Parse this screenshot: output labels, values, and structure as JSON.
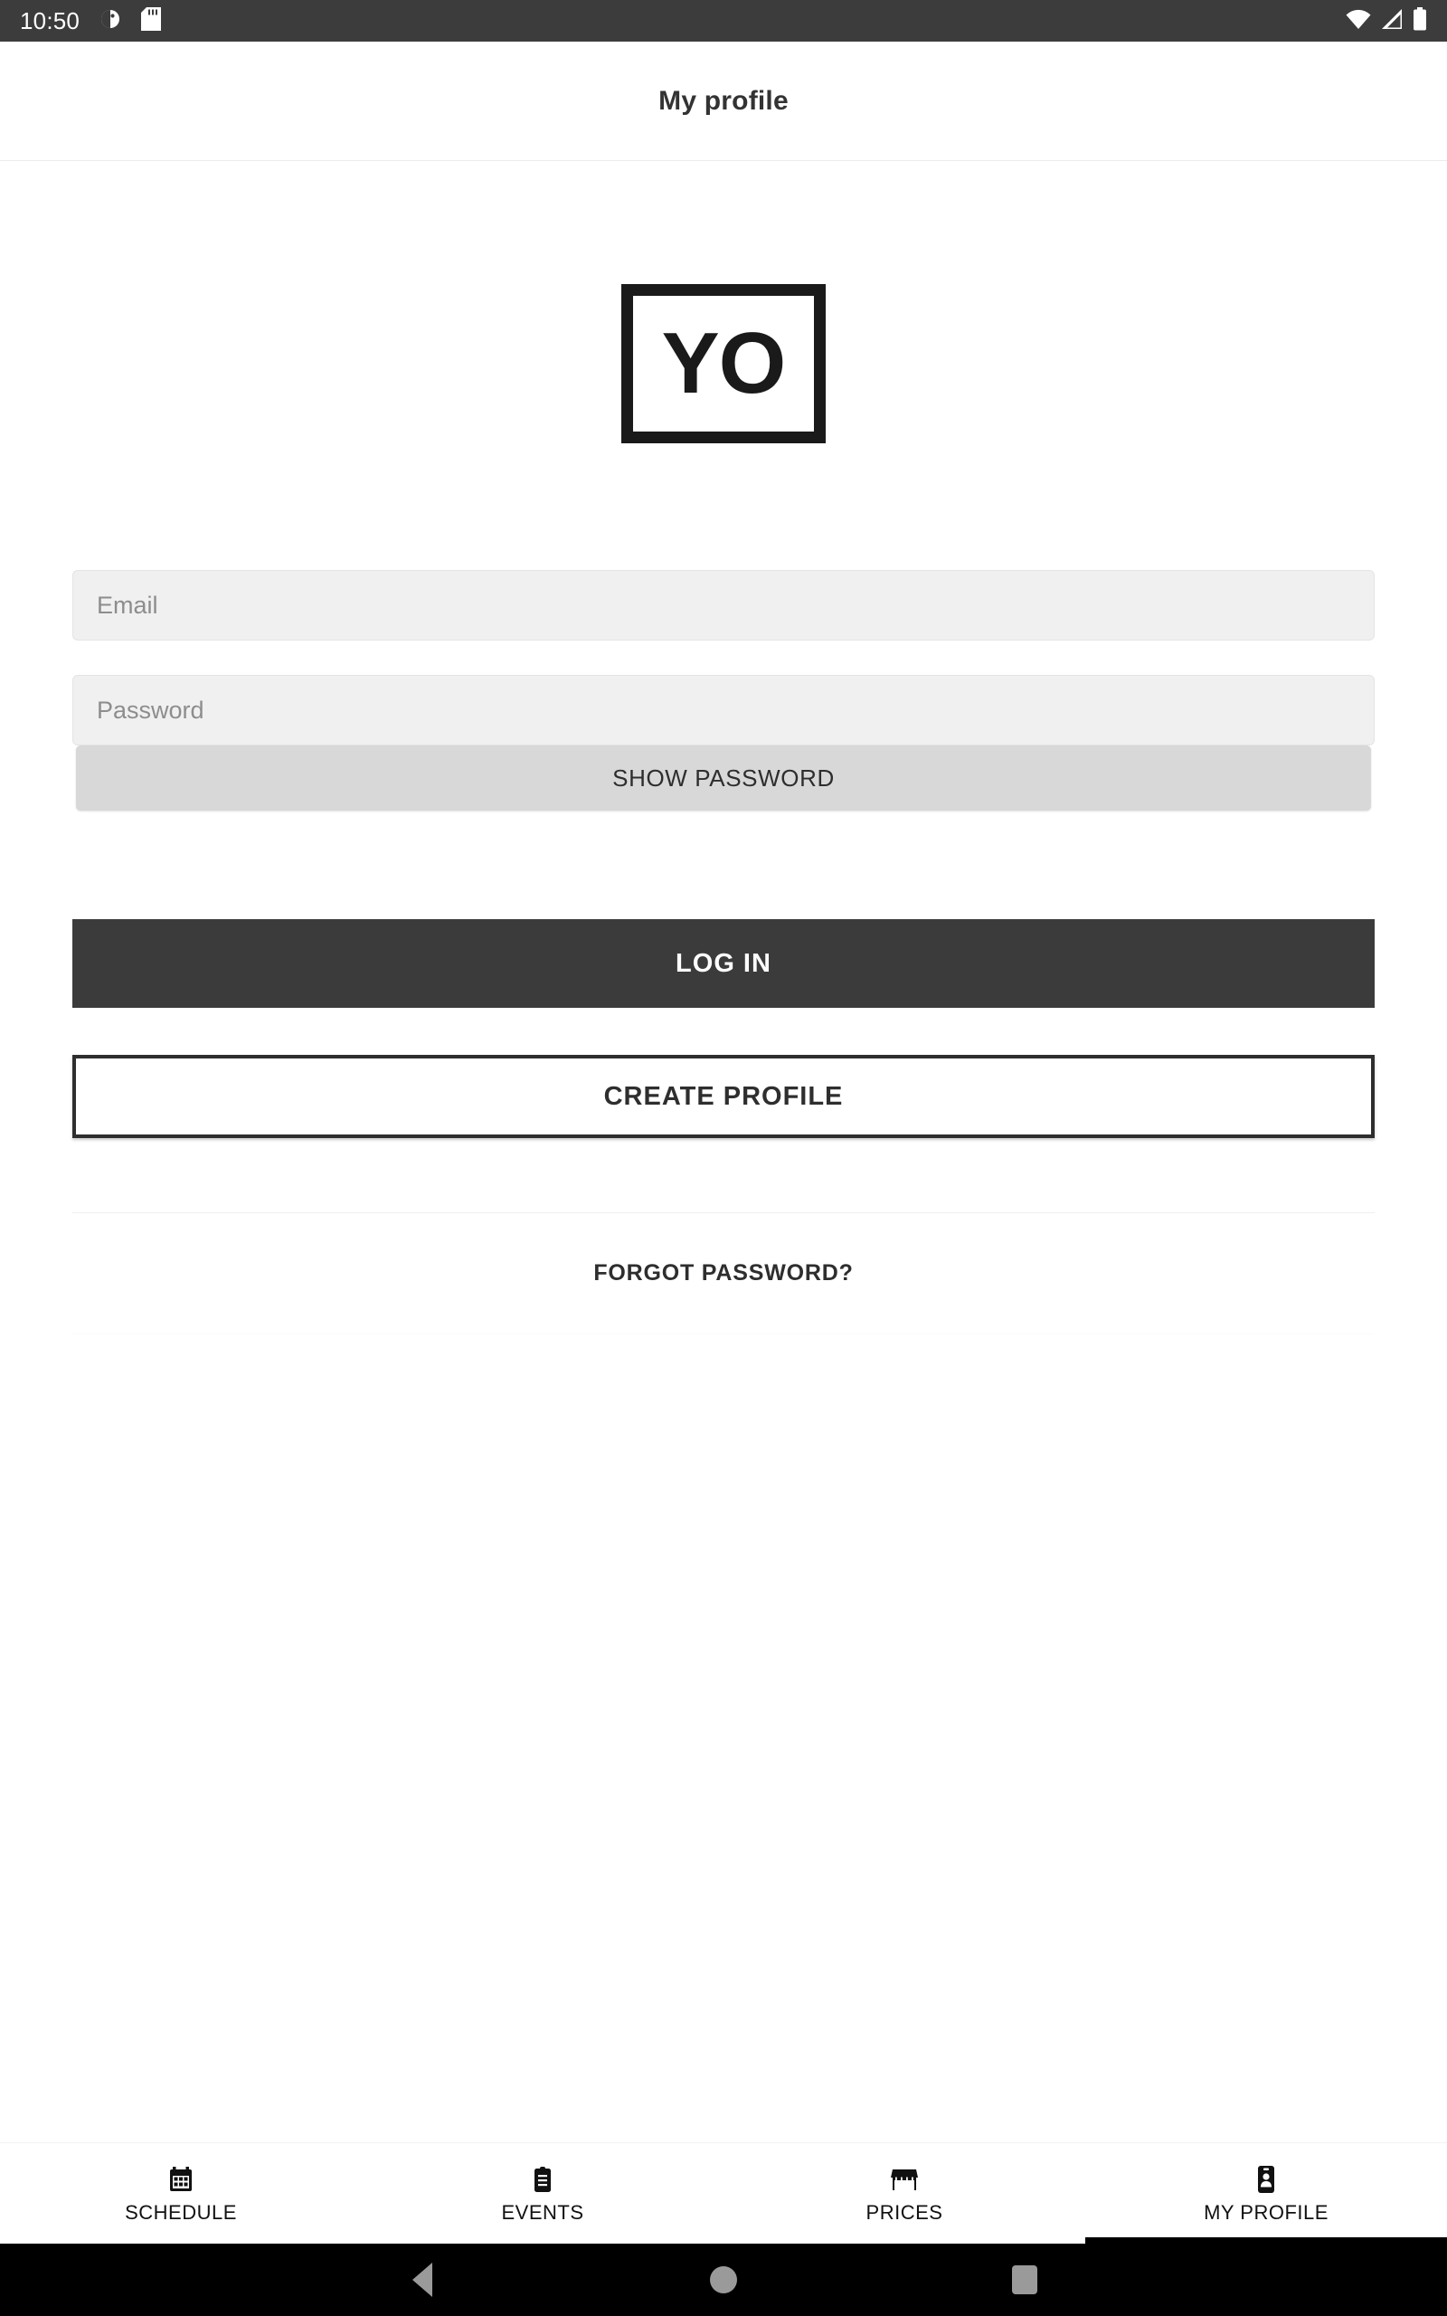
{
  "status_bar": {
    "clock": "10:50",
    "left_icons": [
      "do-not-disturb-icon",
      "sd-card-icon"
    ],
    "right_icons": [
      "wifi-icon",
      "cellular-signal-icon",
      "battery-icon"
    ],
    "background_color": "#3c3c3c",
    "foreground_color": "#ffffff"
  },
  "header": {
    "title": "My profile"
  },
  "logo": {
    "text": "YO",
    "border_color": "#1a1a1a"
  },
  "form": {
    "email": {
      "placeholder": "Email",
      "value": ""
    },
    "password": {
      "placeholder": "Password",
      "value": ""
    },
    "show_password_label": "SHOW PASSWORD",
    "login_label": "LOG IN",
    "create_profile_label": "CREATE PROFILE",
    "forgot_password_label": "FORGOT PASSWORD?"
  },
  "colors": {
    "primary_button_bg": "#3b3b3b",
    "primary_button_text": "#ffffff",
    "outline_button_border": "#2e2e2e",
    "field_bg": "#f0f0f0",
    "show_password_bg": "#d8d8d8",
    "active_tab_indicator": "#000000"
  },
  "tabs": [
    {
      "label": "SCHEDULE",
      "icon": "calendar-icon",
      "active": false
    },
    {
      "label": "EVENTS",
      "icon": "clipboard-icon",
      "active": false
    },
    {
      "label": "PRICES",
      "icon": "storefront-icon",
      "active": false
    },
    {
      "label": "MY PROFILE",
      "icon": "badge-icon",
      "active": true
    }
  ],
  "android_nav": {
    "back_label": "Back",
    "home_label": "Home",
    "recents_label": "Recent apps"
  }
}
